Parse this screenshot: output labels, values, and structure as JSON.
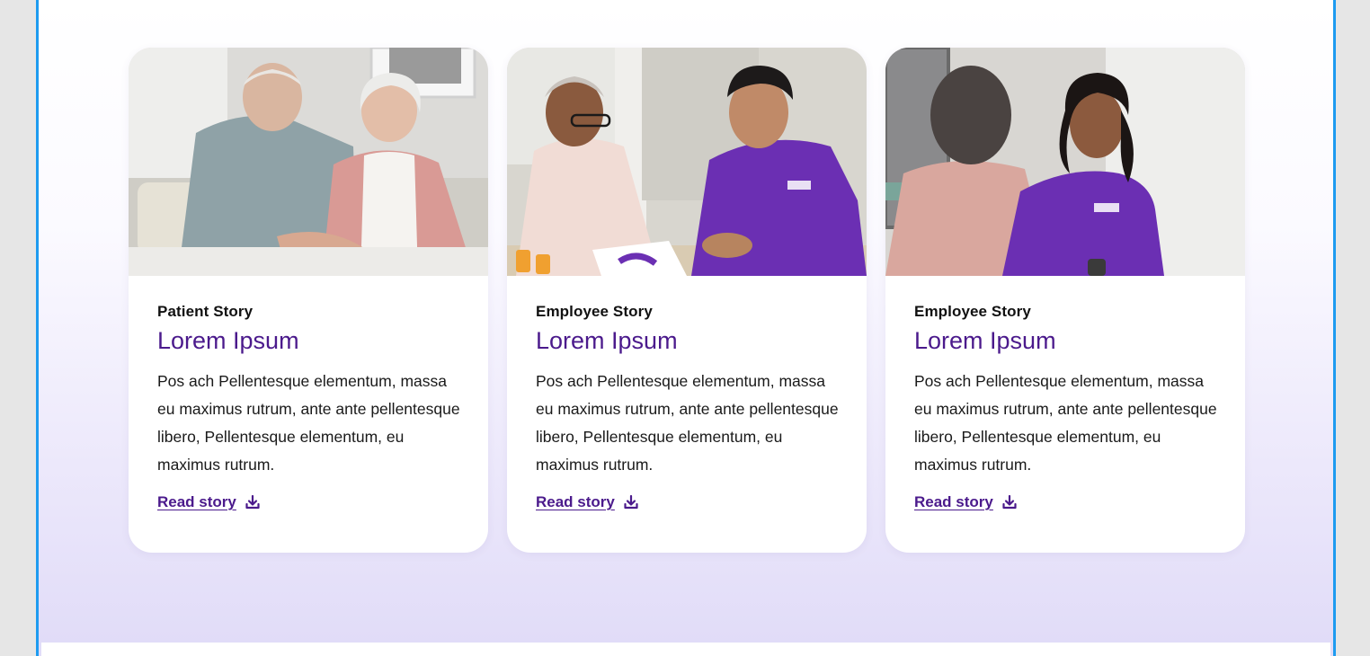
{
  "colors": {
    "accent": "#4b1a8c",
    "frame_border": "#1e9bf0",
    "gradient_bottom": "#e1dcf8"
  },
  "cards": [
    {
      "image_alt": "Elderly couple holding hands on a sofa",
      "eyebrow": "Patient Story",
      "title": "Lorem Ipsum",
      "description": "Pos ach Pellentesque elementum, massa eu maximus rutrum, ante ante pellentesque libero, Pellentesque elementum,  eu maximus rutrum.",
      "link_label": "Read story",
      "link_icon": "download-icon"
    },
    {
      "image_alt": "Caregiver in purple scrubs talking with an older woman at a table",
      "eyebrow": "Employee Story",
      "title": "Lorem Ipsum",
      "description": "Pos ach Pellentesque elementum, massa eu maximus rutrum, ante ante pellentesque libero, Pellentesque elementum,  eu maximus rutrum.",
      "link_label": "Read story",
      "link_icon": "download-icon"
    },
    {
      "image_alt": "Nurse in purple scrubs smiling at a patient",
      "eyebrow": "Employee Story",
      "title": "Lorem Ipsum",
      "description": "Pos ach Pellentesque elementum, massa eu maximus rutrum, ante ante pellentesque libero, Pellentesque elementum,  eu maximus rutrum.",
      "link_label": "Read story",
      "link_icon": "download-icon"
    }
  ]
}
